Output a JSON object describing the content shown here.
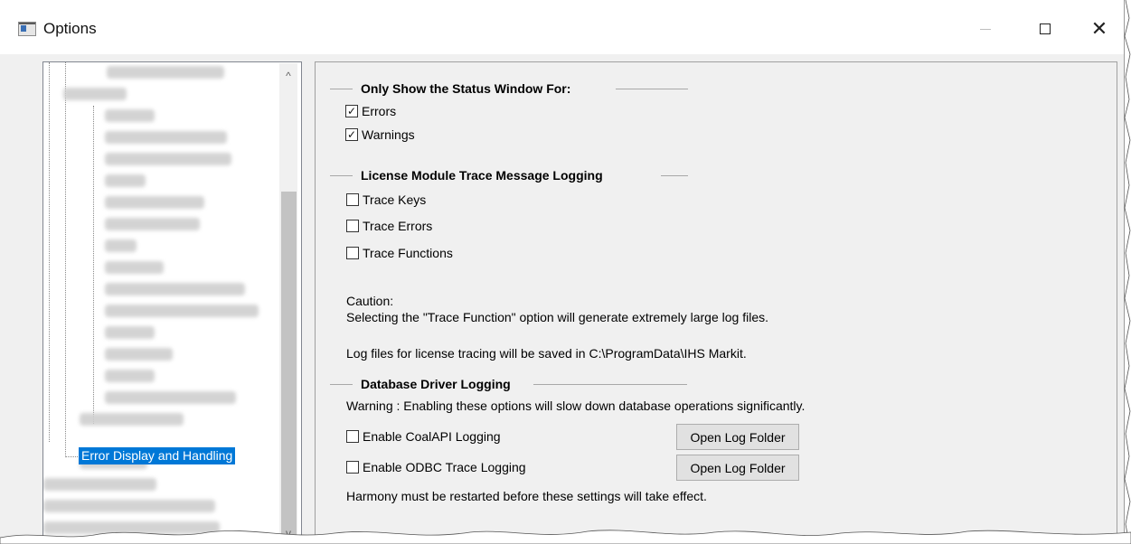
{
  "window": {
    "title": "Options",
    "icon": "options-window-icon",
    "controls": [
      "minimize-icon",
      "maximize-icon",
      "close-icon"
    ],
    "close_glyph": "✕"
  },
  "tree": {
    "selected_item": "Error Display and Handling"
  },
  "status_window": {
    "title": "Only Show the Status Window For:",
    "items": [
      {
        "label": "Errors",
        "checked": true
      },
      {
        "label": "Warnings",
        "checked": true
      }
    ]
  },
  "license_logging": {
    "title": "License Module Trace Message Logging",
    "items": [
      {
        "label": "Trace Keys",
        "checked": false
      },
      {
        "label": "Trace Errors",
        "checked": false
      },
      {
        "label": "Trace Functions",
        "checked": false
      }
    ],
    "caution_heading": "Caution:",
    "caution_text": "Selecting the \"Trace Function\" option will generate extremely large log files.",
    "save_location": "Log files for license tracing will be saved in C:\\ProgramData\\IHS Markit."
  },
  "database_logging": {
    "title": "Database Driver Logging",
    "warning": "Warning : Enabling these options will slow down database operations significantly.",
    "items": [
      {
        "label": "Enable CoalAPI Logging",
        "checked": false,
        "button": "Open Log Folder"
      },
      {
        "label": "Enable ODBC Trace Logging",
        "checked": false,
        "button": "Open Log Folder"
      }
    ],
    "restart_note": "Harmony must be restarted before these settings will take effect."
  },
  "scrollbar": {
    "up_arrow": "^",
    "down_arrow": "v"
  },
  "colors": {
    "selection": "#0078d7",
    "background": "#f0f0f0"
  }
}
